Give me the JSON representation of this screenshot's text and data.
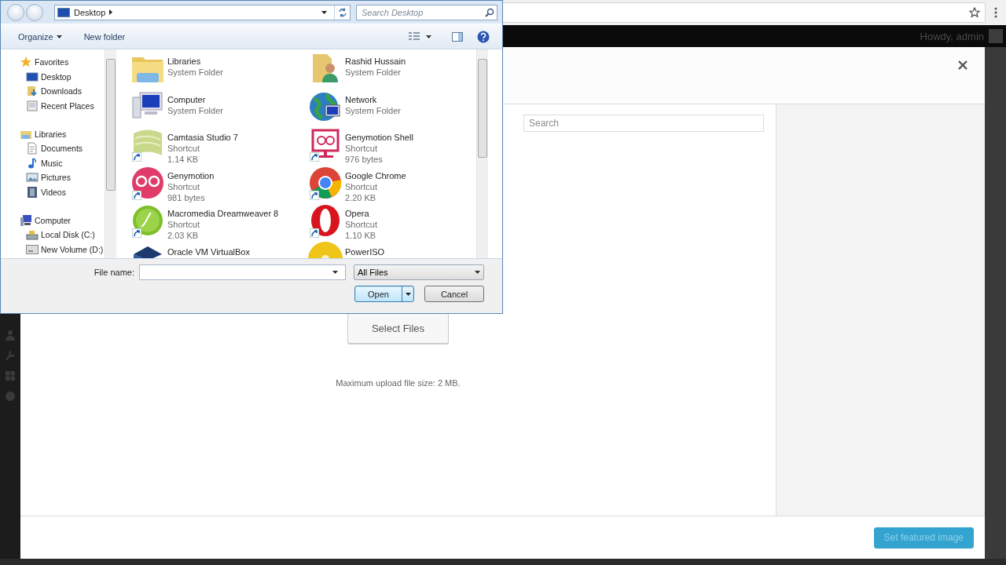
{
  "browser": {
    "admin_bar": {
      "greeting": "Howdy, admin"
    }
  },
  "media_modal": {
    "search": {
      "placeholder": "Search"
    },
    "upload_button": "Select Files",
    "max_upload": "Maximum upload file size: 2 MB.",
    "primary_button": {
      "label": "Set featured image",
      "disabled": true
    }
  },
  "dialog": {
    "location": "Desktop",
    "search": {
      "placeholder": "Search Desktop"
    },
    "toolbar": [
      {
        "label": "Organize",
        "kind": "menu"
      },
      {
        "label": "New folder",
        "kind": "button"
      }
    ],
    "nav": [
      {
        "label": "Favorites",
        "children": [
          {
            "label": "Desktop"
          },
          {
            "label": "Downloads"
          },
          {
            "label": "Recent Places"
          }
        ]
      },
      {
        "label": "Libraries",
        "children": [
          {
            "label": "Documents"
          },
          {
            "label": "Music"
          },
          {
            "label": "Pictures"
          },
          {
            "label": "Videos"
          }
        ]
      },
      {
        "label": "Computer",
        "children": [
          {
            "label": "Local Disk (C:)"
          },
          {
            "label": "New Volume (D:)"
          }
        ]
      }
    ],
    "files": [
      {
        "name": "Libraries",
        "kind": "folder",
        "type": "System Folder"
      },
      {
        "name": "Rashid Hussain",
        "kind": "folder",
        "type": "System Folder"
      },
      {
        "name": "Computer",
        "kind": "folder",
        "type": "System Folder"
      },
      {
        "name": "Network",
        "kind": "folder",
        "type": "System Folder"
      },
      {
        "name": "Camtasia Studio 7",
        "kind": "shortcut",
        "type": "Shortcut",
        "size": "1.14 KB"
      },
      {
        "name": "Genymotion Shell",
        "kind": "shortcut",
        "type": "Shortcut",
        "size": "976 bytes"
      },
      {
        "name": "Genymotion",
        "kind": "shortcut",
        "type": "Shortcut",
        "size": "981 bytes"
      },
      {
        "name": "Google Chrome",
        "kind": "shortcut",
        "type": "Shortcut",
        "size": "2.20 KB"
      },
      {
        "name": "Macromedia Dreamweaver 8",
        "kind": "shortcut",
        "type": "Shortcut",
        "size": "2.03 KB"
      },
      {
        "name": "Opera",
        "kind": "shortcut",
        "type": "Shortcut",
        "size": "1.10 KB"
      },
      {
        "name": "Oracle VM VirtualBox"
      },
      {
        "name": "PowerISO"
      }
    ],
    "file_name": {
      "label": "File name:"
    },
    "file_type": "All Files",
    "buttons": [
      {
        "label": "Open",
        "kind": "split",
        "default": true
      },
      {
        "label": "Cancel",
        "kind": "plain",
        "default": false
      }
    ]
  }
}
